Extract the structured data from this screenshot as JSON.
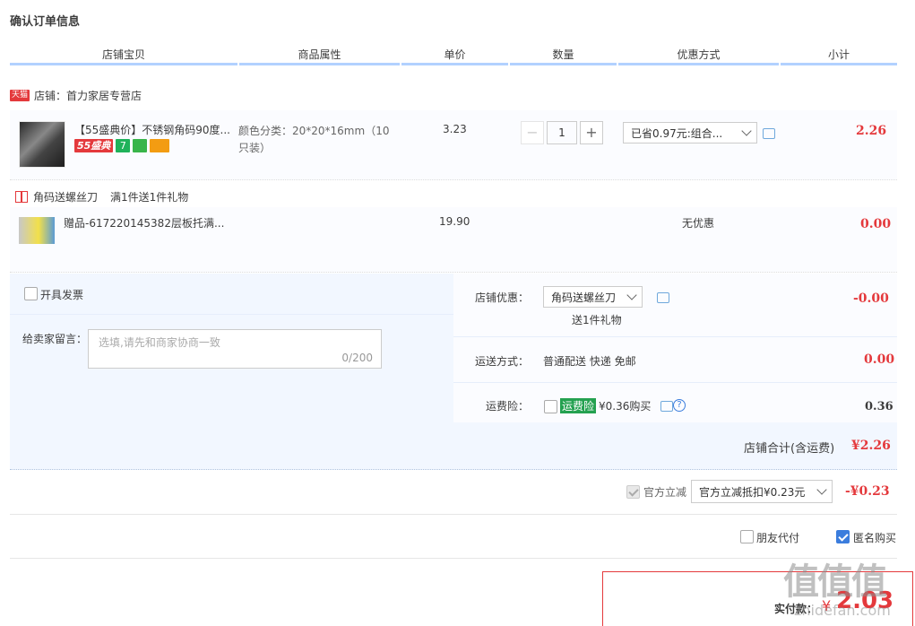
{
  "page": {
    "title": "确认订单信息"
  },
  "columns": [
    "店铺宝贝",
    "商品属性",
    "单价",
    "数量",
    "优惠方式",
    "小计"
  ],
  "shop": {
    "badge": "天猫",
    "label": "店铺：首力家居专营店"
  },
  "item": {
    "title": "【55盛典价】不锈钢角码90度...",
    "tag_55": "55盛典",
    "tag_7": "7",
    "attr_line1": "颜色分类：20*20*16mm（10",
    "attr_line2": "只装）",
    "unit_price": "3.23",
    "quantity": "1",
    "minus_label": "−",
    "plus_label": "+",
    "discount_select": "已省0.97元:组合...",
    "subtotal": "2.26"
  },
  "gift": {
    "promo_name": "角码送螺丝刀",
    "promo_desc": "满1件送1件礼物",
    "title": "赠品-617220145382层板托满...",
    "unit_price": "19.90",
    "discount": "无优惠",
    "subtotal": "0.00"
  },
  "invoice": {
    "label": "开具发票"
  },
  "message": {
    "label": "给卖家留言：",
    "placeholder": "选填,请先和商家协商一致",
    "counter": "0/200"
  },
  "shop_discount": {
    "label": "店铺优惠：",
    "select": "角码送螺丝刀",
    "note": "送1件礼物",
    "amount": "-0.00"
  },
  "shipping": {
    "label": "运送方式：",
    "value": "普通配送 快递 免邮",
    "amount": "0.00"
  },
  "insurance": {
    "label": "运费险：",
    "tag": "运费险",
    "price": "¥0.36购买",
    "help": "?",
    "amount": "0.36"
  },
  "shop_total": {
    "label": "店铺合计(含运费)",
    "amount": "¥2.26"
  },
  "official": {
    "label": "官方立减",
    "select": "官方立减抵扣¥0.23元",
    "amount": "-¥0.23"
  },
  "options": {
    "friend_pay": "朋友代付",
    "anonymous": "匿名购买"
  },
  "final": {
    "label": "实付款：",
    "currency": "¥",
    "amount": "2.03"
  },
  "watermark": {
    "logo": "值值值",
    "url": "zhidefan.com"
  },
  "colors": {
    "accent_red": "#e4393c",
    "header_line": "#b2d1ff",
    "panel_blue": "#f2f7ff",
    "check_blue": "#3b7ddd"
  }
}
